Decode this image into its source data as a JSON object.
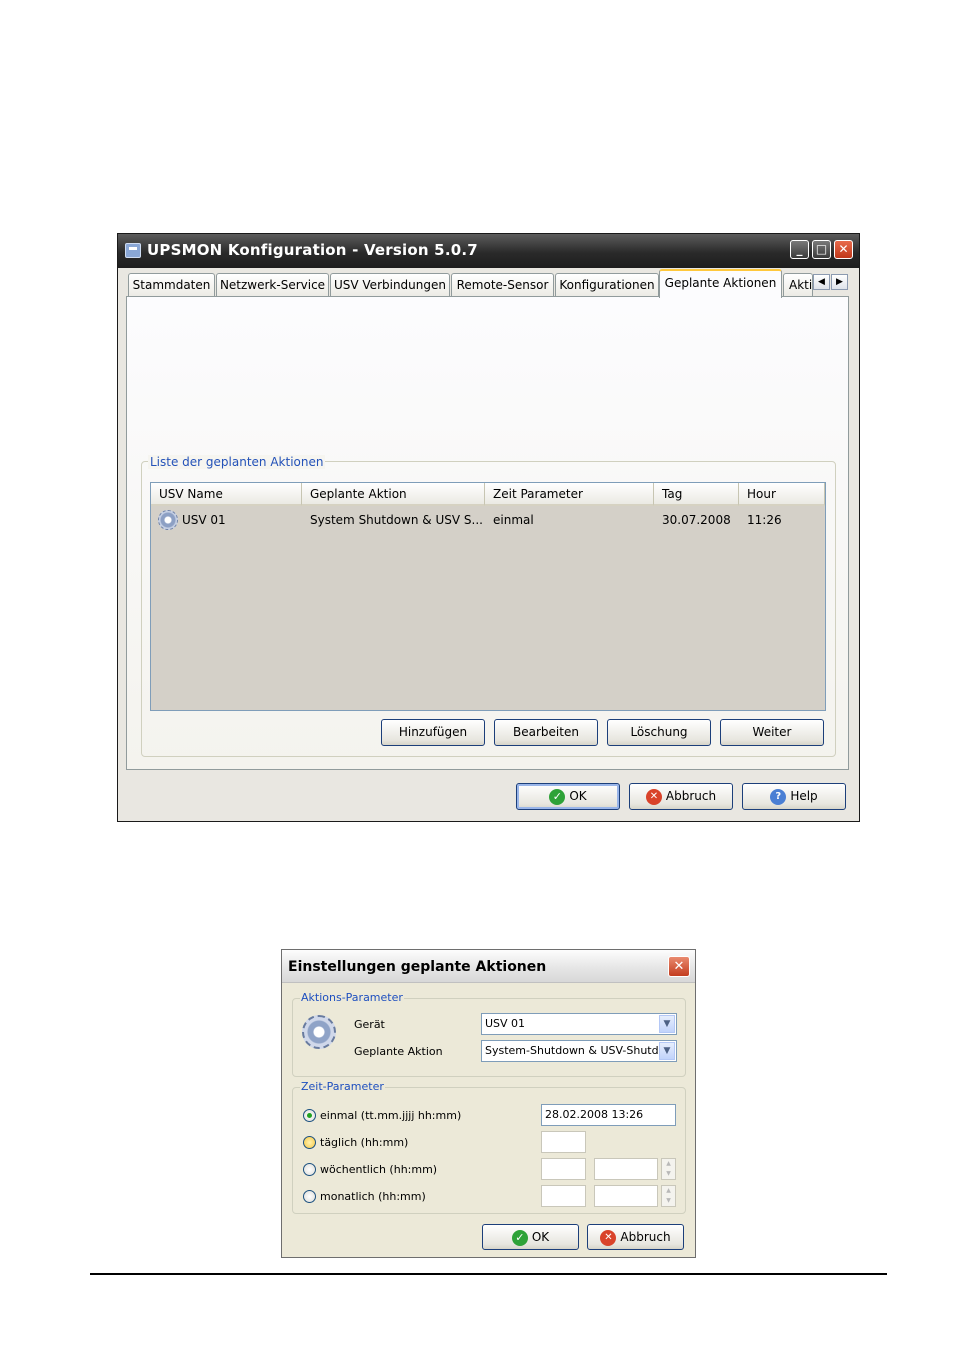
{
  "main_window": {
    "title": "UPSMON Konfiguration - Version 5.0.7",
    "tabs": [
      "Stammdaten",
      "Netzwerk-Service",
      "USV Verbindungen",
      "Remote-Sensor",
      "Konfigurationen",
      "Geplante Aktionen",
      "Akti"
    ],
    "active_tab": "Geplante Aktionen",
    "group_label": "Liste der geplanten Aktionen",
    "list": {
      "columns": [
        "USV Name",
        "Geplante Aktion",
        "Zeit Parameter",
        "Tag",
        "Hour"
      ],
      "rows": [
        {
          "usv_name": "USV 01",
          "aktion": "System Shutdown & USV S...",
          "zeit": "einmal",
          "tag": "30.07.2008",
          "hour": "11:26"
        }
      ]
    },
    "list_buttons": {
      "add": "Hinzufügen",
      "edit": "Bearbeiten",
      "delete": "Löschung",
      "next": "Weiter"
    },
    "footer_buttons": {
      "ok": "OK",
      "cancel": "Abbruch",
      "help": "Help"
    },
    "icons": [
      "app-icon",
      "minimize-icon",
      "maximize-icon",
      "close-icon",
      "scroll-left-icon",
      "scroll-right-icon",
      "schedule-gear-icon",
      "check-icon",
      "cancel-icon",
      "help-icon"
    ]
  },
  "dialog": {
    "title": "Einstellungen geplante Aktionen",
    "aktions_parameter": {
      "label": "Aktions-Parameter",
      "geraet_label": "Gerät",
      "geraet_value": "USV 01",
      "aktion_label": "Geplante Aktion",
      "aktion_value": "System-Shutdown & USV-Shutdo"
    },
    "zeit_parameter": {
      "label": "Zeit-Parameter",
      "options": [
        {
          "label": "einmal (tt.mm.jjjj hh:mm)",
          "value": "28.02.2008 13:26",
          "checked": true
        },
        {
          "label": "täglich (hh:mm)",
          "value": "",
          "checked": false
        },
        {
          "label": "wöchentlich (hh:mm)",
          "value": "",
          "checked": false
        },
        {
          "label": "monatlich (hh:mm)",
          "value": "",
          "checked": false
        }
      ]
    },
    "buttons": {
      "ok": "OK",
      "cancel": "Abbruch"
    }
  },
  "colors": {
    "title_bar_dark": "#2a2a2a",
    "active_tab_accent": "#ffc83c",
    "group_label_blue": "#2452b8",
    "ok_green": "#2ea238",
    "cancel_red": "#d9432a"
  }
}
